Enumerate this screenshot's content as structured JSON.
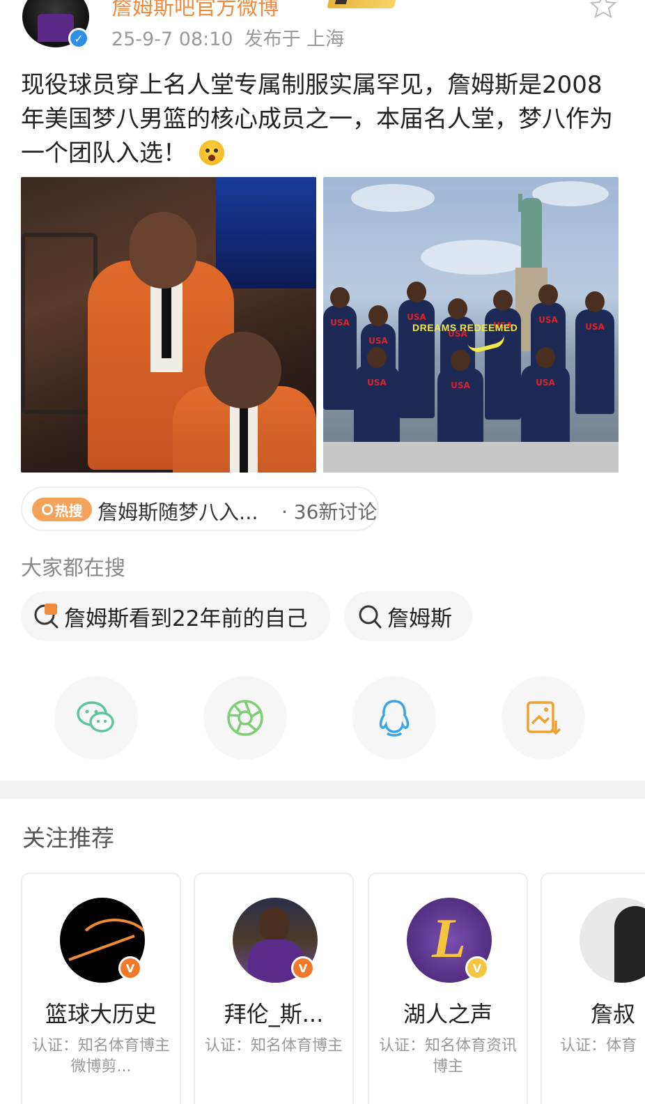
{
  "post": {
    "author": "詹姆斯吧官方微博",
    "timestamp": "25-9-7 08:10",
    "location": "发布于 上海",
    "text": "现役球员穿上名人堂专属制服实属罕见，詹姆斯是2008年美国梦八男篮的核心成员之一，本届名人堂，梦八作为一个团队入选！",
    "image2_caption": "DREAMS REDEEMED",
    "image2_jersey_labels": [
      "USA",
      "USA",
      "USA",
      "USA",
      "USA",
      "USA",
      "USA",
      "USA",
      "USA",
      "USA"
    ]
  },
  "hot_topic": {
    "badge": "热搜",
    "title": "詹姆斯随梦八入...",
    "count": "· 36新讨论"
  },
  "search_section": {
    "label": "大家都在搜",
    "items": [
      {
        "text": "詹姆斯看到22年前的自己",
        "icon": "hot-search-icon"
      },
      {
        "text": "詹姆斯",
        "icon": "search-icon"
      }
    ]
  },
  "share_icons": [
    "wechat-icon",
    "moments-icon",
    "qq-icon",
    "save-image-icon"
  ],
  "recommend": {
    "title": "关注推荐",
    "cards": [
      {
        "name": "篮球大历史",
        "desc": "认证：知名体育博主 微博剪...",
        "badge_color": "#f07a2a"
      },
      {
        "name": "拜伦_斯...",
        "desc": "认证：知名体育博主",
        "badge_color": "#f07a2a"
      },
      {
        "name": "湖人之声",
        "desc": "认证：知名体育资讯博主",
        "badge_color": "#f5c542"
      },
      {
        "name": "詹叔",
        "desc": "认证：体育",
        "badge_color": "#f07a2a"
      }
    ]
  },
  "colors": {
    "accent": "#f08a3c",
    "verified": "#2d8fe6",
    "wechat": "#5ec59a",
    "moments": "#7ccf74",
    "qq": "#3aa6e6",
    "save": "#f0a030"
  }
}
